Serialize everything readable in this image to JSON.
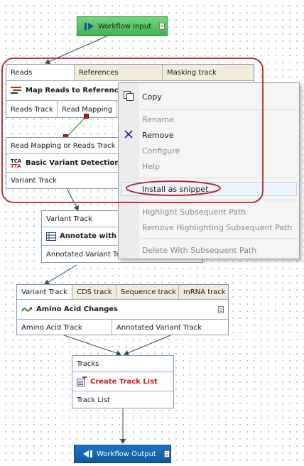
{
  "workflow_input": {
    "label": "Workflow Input"
  },
  "map_reads": {
    "inputs": [
      "Reads",
      "References",
      "Masking track"
    ],
    "title": "Map Reads to Reference",
    "outputs": [
      "Reads Track",
      "Read Mapping"
    ]
  },
  "variant_detection": {
    "input": "Read Mapping or Reads Track",
    "title": "Basic Variant Detection",
    "output": "Variant Track"
  },
  "annotate": {
    "input": "Variant Track",
    "title": "Annotate with C",
    "output": "Annotated Variant Tr"
  },
  "amino_acid": {
    "inputs": [
      "Variant Track",
      "CDS track",
      "Sequence track",
      "mRNA track"
    ],
    "title": "Amino Acid Changes",
    "outputs": [
      "Amino Acid Track",
      "Annotated Variant Track"
    ]
  },
  "track_list": {
    "input": "Tracks",
    "title": "Create Track List",
    "output": "Track List"
  },
  "workflow_output": {
    "label": "Workflow Output"
  },
  "context_menu": {
    "copy": "Copy",
    "rename": "Rename",
    "remove": "Remove",
    "configure": "Configure",
    "help": "Help",
    "install_snippet": "Install as snippet...",
    "highlight_path": "Highlight Subsequent Path",
    "remove_highlighting": "Remove Highlighting Subsequent Path",
    "delete_path": "Delete With Subsequent Path"
  },
  "colors": {
    "highlight_ellipse": "#b81f2d",
    "connector": "#2f4f4f",
    "input_green": "#4cbc5c",
    "output_blue": "#1565ad",
    "port_tan": "#f3ecdb",
    "title_red": "#cc1f1f"
  }
}
